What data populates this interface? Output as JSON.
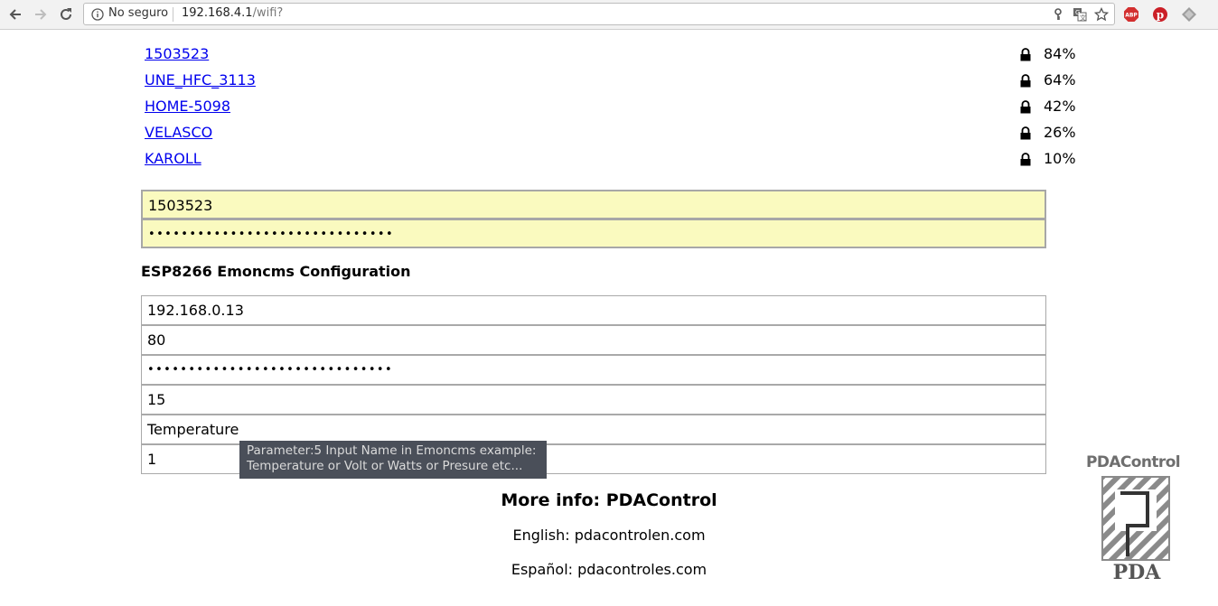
{
  "browser": {
    "security_label": "No seguro",
    "url_host": "192.168.4.1",
    "url_path": "/wifi?",
    "icons": [
      "back-arrow-icon",
      "forward-arrow-icon",
      "reload-icon",
      "info-icon",
      "key-icon",
      "translate-icon",
      "star-icon",
      "adblock-icon",
      "pinterest-icon",
      "extension-icon"
    ],
    "colors": {
      "adblock": "#d32f2f",
      "pinterest": "#cb1f27"
    }
  },
  "networks": [
    {
      "ssid": "1503523",
      "quality": "84%"
    },
    {
      "ssid": "UNE_HFC_3113",
      "quality": "64%"
    },
    {
      "ssid": "HOME-5098",
      "quality": "42%"
    },
    {
      "ssid": "VELASCO",
      "quality": "26%"
    },
    {
      "ssid": "KAROLL",
      "quality": "10%"
    }
  ],
  "wifi_form": {
    "ssid_value": "1503523",
    "password_value": "••••••••••••••••••••••••••••••"
  },
  "emoncms": {
    "title": "ESP8266 Emoncms Configuration",
    "server_value": "192.168.0.13",
    "port_value": "80",
    "apikey_value": "••••••••••••••••••••••••••••••",
    "interval_value": "15",
    "input_name_value": "Temperature",
    "node_value": "1",
    "tooltip_line1": "Parameter:5 Input Name in Emoncms  example:",
    "tooltip_line2": "Temperature or Volt or Watts or Presure etc..."
  },
  "footer": {
    "more_info": "More info: PDAControl",
    "english": "English: pdacontrolen.com",
    "spanish": "Español: pdacontroles.com"
  },
  "logo": {
    "text": "PDAControl"
  }
}
